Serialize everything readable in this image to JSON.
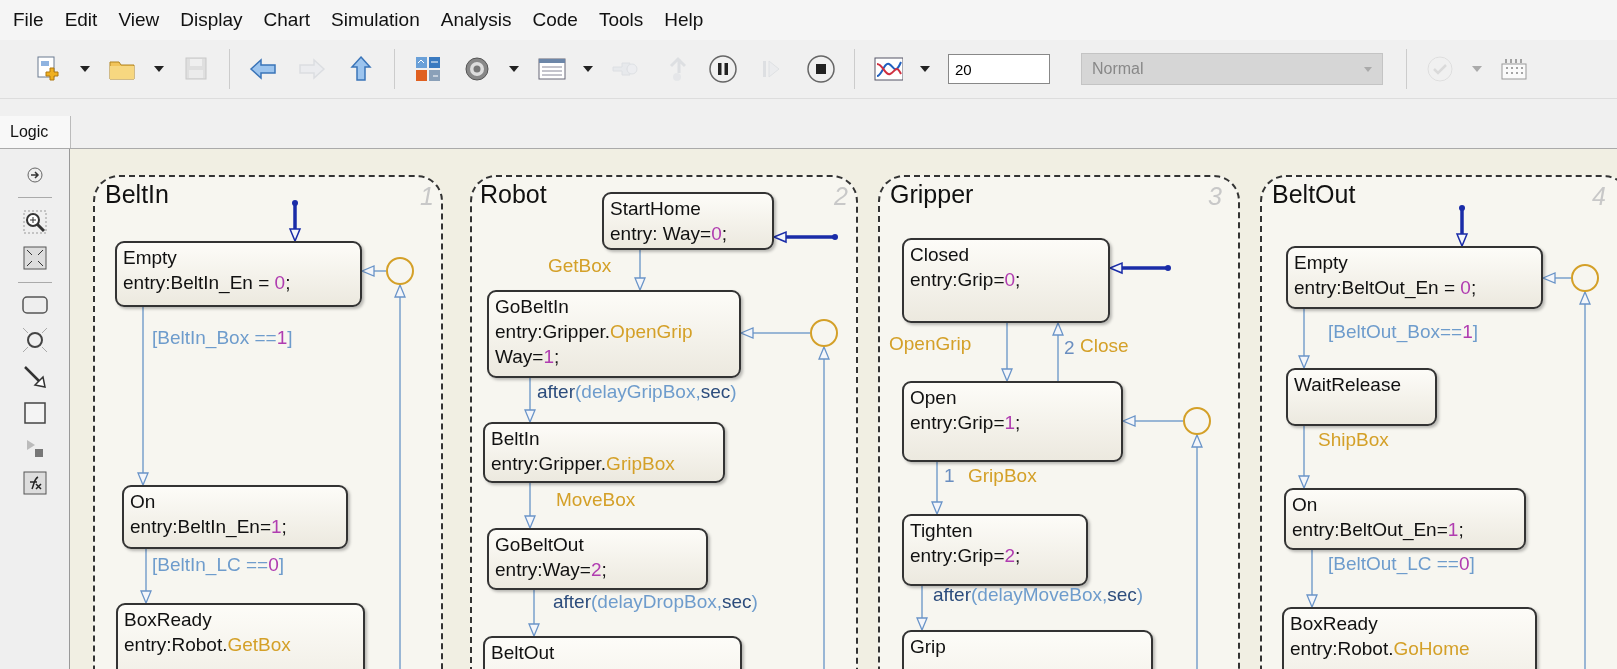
{
  "menu": [
    "File",
    "Edit",
    "View",
    "Display",
    "Chart",
    "Simulation",
    "Analysis",
    "Code",
    "Tools",
    "Help"
  ],
  "toolbar": [
    {
      "kind": "button",
      "disabled": false
    },
    {
      "kind": "caret",
      "disabled": false
    },
    {
      "kind": "button",
      "disabled": false
    },
    {
      "kind": "caret",
      "disabled": false
    },
    {
      "kind": "button",
      "disabled": true
    },
    {
      "kind": "separator"
    },
    {
      "kind": "button",
      "disabled": false
    },
    {
      "kind": "button",
      "disabled": true
    },
    {
      "kind": "button",
      "disabled": false
    },
    {
      "kind": "separator"
    },
    {
      "kind": "button",
      "disabled": false
    },
    {
      "kind": "button",
      "disabled": false
    },
    {
      "kind": "caret",
      "disabled": false
    },
    {
      "kind": "button",
      "disabled": false
    },
    {
      "kind": "caret",
      "disabled": false
    },
    {
      "kind": "button",
      "disabled": true
    },
    {
      "kind": "button",
      "disabled": true
    },
    {
      "kind": "button",
      "disabled": false
    },
    {
      "kind": "button",
      "disabled": true
    },
    {
      "kind": "button",
      "disabled": false
    },
    {
      "kind": "separator"
    },
    {
      "kind": "button",
      "disabled": false
    },
    {
      "kind": "caret",
      "disabled": false
    },
    {
      "kind": "field",
      "value": "20"
    },
    {
      "kind": "dropdown",
      "value": "Normal",
      "disabled": true
    },
    {
      "kind": "separator"
    },
    {
      "kind": "button",
      "disabled": true
    },
    {
      "kind": "caret",
      "disabled": true
    },
    {
      "kind": "button",
      "disabled": false
    }
  ],
  "tabs": [
    {
      "label": "Logic",
      "selected": true
    }
  ],
  "charts": [
    {
      "title": "BeltIn",
      "order": "1",
      "states": [
        {
          "lines": [
            [
              {
                "text": "Empty",
                "kind": "plain"
              }
            ],
            [
              {
                "text": "entry:BeltIn_En = ",
                "kind": "plain"
              },
              {
                "text": "0",
                "kind": "number"
              },
              {
                "text": ";",
                "kind": "plain"
              }
            ]
          ]
        },
        {
          "lines": [
            [
              {
                "text": "On",
                "kind": "plain"
              }
            ],
            [
              {
                "text": "entry:BeltIn_En=",
                "kind": "plain"
              },
              {
                "text": "1",
                "kind": "number"
              },
              {
                "text": ";",
                "kind": "plain"
              }
            ]
          ]
        },
        {
          "lines": [
            [
              {
                "text": "BoxReady",
                "kind": "plain"
              }
            ],
            [
              {
                "text": "entry:Robot.",
                "kind": "plain"
              },
              {
                "text": "GetBox",
                "kind": "event"
              }
            ]
          ]
        }
      ],
      "transitions": [
        {
          "label": [
            {
              "text": "[BeltIn_Box ==",
              "kind": "condition"
            },
            {
              "text": "1",
              "kind": "number"
            },
            {
              "text": "]",
              "kind": "condition"
            }
          ]
        },
        {
          "label": [
            {
              "text": "[BeltIn_LC ==",
              "kind": "condition"
            },
            {
              "text": "0",
              "kind": "number"
            },
            {
              "text": "]",
              "kind": "condition"
            }
          ]
        }
      ]
    },
    {
      "title": "Robot",
      "order": "2",
      "states": [
        {
          "lines": [
            [
              {
                "text": "StartHome",
                "kind": "plain"
              }
            ],
            [
              {
                "text": "entry: Way=",
                "kind": "plain"
              },
              {
                "text": "0",
                "kind": "number"
              },
              {
                "text": ";",
                "kind": "plain"
              }
            ]
          ]
        },
        {
          "lines": [
            [
              {
                "text": "GoBeltIn",
                "kind": "plain"
              }
            ],
            [
              {
                "text": "entry:Gripper.",
                "kind": "plain"
              },
              {
                "text": "OpenGrip",
                "kind": "event"
              }
            ],
            [
              {
                "text": "Way=",
                "kind": "plain"
              },
              {
                "text": "1",
                "kind": "number"
              },
              {
                "text": ";",
                "kind": "plain"
              }
            ]
          ]
        },
        {
          "lines": [
            [
              {
                "text": "BeltIn",
                "kind": "plain"
              }
            ],
            [
              {
                "text": "entry:Gripper.",
                "kind": "plain"
              },
              {
                "text": "GripBox",
                "kind": "event"
              }
            ]
          ]
        },
        {
          "lines": [
            [
              {
                "text": "GoBeltOut",
                "kind": "plain"
              }
            ],
            [
              {
                "text": "entry:Way=",
                "kind": "plain"
              },
              {
                "text": "2",
                "kind": "number"
              },
              {
                "text": ";",
                "kind": "plain"
              }
            ]
          ]
        },
        {
          "lines": [
            [
              {
                "text": "BeltOut",
                "kind": "plain"
              }
            ]
          ]
        }
      ],
      "transitions": [
        {
          "label": [
            {
              "text": "GetBox",
              "kind": "event"
            }
          ]
        },
        {
          "label": [
            {
              "text": "after",
              "kind": "keyword"
            },
            {
              "text": "(delayGripBox,",
              "kind": "condition"
            },
            {
              "text": "sec",
              "kind": "keyword"
            },
            {
              "text": ")",
              "kind": "condition"
            }
          ]
        },
        {
          "label": [
            {
              "text": "MoveBox",
              "kind": "event"
            }
          ]
        },
        {
          "label": [
            {
              "text": "after",
              "kind": "keyword"
            },
            {
              "text": "(delayDropBox,",
              "kind": "condition"
            },
            {
              "text": "sec",
              "kind": "keyword"
            },
            {
              "text": ")",
              "kind": "condition"
            }
          ]
        }
      ]
    },
    {
      "title": "Gripper",
      "order": "3",
      "states": [
        {
          "lines": [
            [
              {
                "text": "Closed",
                "kind": "plain"
              }
            ],
            [
              {
                "text": "entry:Grip=",
                "kind": "plain"
              },
              {
                "text": "0",
                "kind": "number"
              },
              {
                "text": ";",
                "kind": "plain"
              }
            ]
          ]
        },
        {
          "lines": [
            [
              {
                "text": "Open",
                "kind": "plain"
              }
            ],
            [
              {
                "text": "entry:Grip=",
                "kind": "plain"
              },
              {
                "text": "1",
                "kind": "number"
              },
              {
                "text": ";",
                "kind": "plain"
              }
            ]
          ]
        },
        {
          "lines": [
            [
              {
                "text": "Tighten",
                "kind": "plain"
              }
            ],
            [
              {
                "text": "entry:Grip=",
                "kind": "plain"
              },
              {
                "text": "2",
                "kind": "number"
              },
              {
                "text": ";",
                "kind": "plain"
              }
            ]
          ]
        },
        {
          "lines": [
            [
              {
                "text": "Grip",
                "kind": "plain"
              }
            ]
          ]
        }
      ],
      "transitions": [
        {
          "label": [
            {
              "text": "OpenGrip",
              "kind": "event"
            }
          ]
        },
        {
          "order": "2",
          "label": [
            {
              "text": "Close",
              "kind": "event"
            }
          ]
        },
        {
          "order": "1",
          "label": [
            {
              "text": "GripBox",
              "kind": "event"
            }
          ]
        },
        {
          "label": [
            {
              "text": "after",
              "kind": "keyword"
            },
            {
              "text": "(delayMoveBox,",
              "kind": "condition"
            },
            {
              "text": "sec",
              "kind": "keyword"
            },
            {
              "text": ")",
              "kind": "condition"
            }
          ]
        }
      ]
    },
    {
      "title": "BeltOut",
      "order": "4",
      "states": [
        {
          "lines": [
            [
              {
                "text": "Empty",
                "kind": "plain"
              }
            ],
            [
              {
                "text": "entry:BeltOut_En = ",
                "kind": "plain"
              },
              {
                "text": "0",
                "kind": "number"
              },
              {
                "text": ";",
                "kind": "plain"
              }
            ]
          ]
        },
        {
          "lines": [
            [
              {
                "text": "WaitRelease",
                "kind": "plain"
              }
            ]
          ]
        },
        {
          "lines": [
            [
              {
                "text": "On",
                "kind": "plain"
              }
            ],
            [
              {
                "text": "entry:BeltOut_En=",
                "kind": "plain"
              },
              {
                "text": "1",
                "kind": "number"
              },
              {
                "text": ";",
                "kind": "plain"
              }
            ]
          ]
        },
        {
          "lines": [
            [
              {
                "text": "BoxReady",
                "kind": "plain"
              }
            ],
            [
              {
                "text": "entry:Robot.",
                "kind": "plain"
              },
              {
                "text": "GoHome",
                "kind": "event"
              }
            ]
          ]
        }
      ],
      "transitions": [
        {
          "label": [
            {
              "text": "[BeltOut_Box==",
              "kind": "condition"
            },
            {
              "text": "1",
              "kind": "number"
            },
            {
              "text": "]",
              "kind": "condition"
            }
          ]
        },
        {
          "label": [
            {
              "text": "ShipBox",
              "kind": "event"
            }
          ]
        },
        {
          "label": [
            {
              "text": "[BeltOut_LC ==",
              "kind": "condition"
            },
            {
              "text": "0",
              "kind": "number"
            },
            {
              "text": "]",
              "kind": "condition"
            }
          ]
        }
      ]
    }
  ]
}
